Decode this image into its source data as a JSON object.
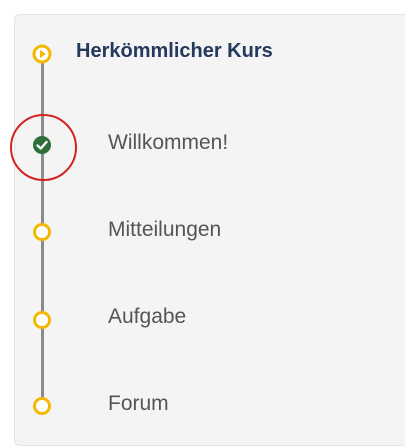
{
  "course": {
    "title": "Herkömmlicher Kurs",
    "icon": "play-circle-icon"
  },
  "items": [
    {
      "label": "Willkommen!",
      "status": "completed",
      "icon": "checkmark-circle-icon",
      "highlighted": true
    },
    {
      "label": "Mitteilungen",
      "status": "open",
      "icon": "open-circle-icon"
    },
    {
      "label": "Aufgabe",
      "status": "open",
      "icon": "open-circle-icon"
    },
    {
      "label": "Forum",
      "status": "open",
      "icon": "open-circle-icon"
    }
  ],
  "colors": {
    "accent": "#f5b800",
    "completed": "#2f6d3b",
    "title": "#233a5d",
    "highlight_ring": "#d42222",
    "line": "#8c8c8c",
    "item_text": "#555555"
  }
}
